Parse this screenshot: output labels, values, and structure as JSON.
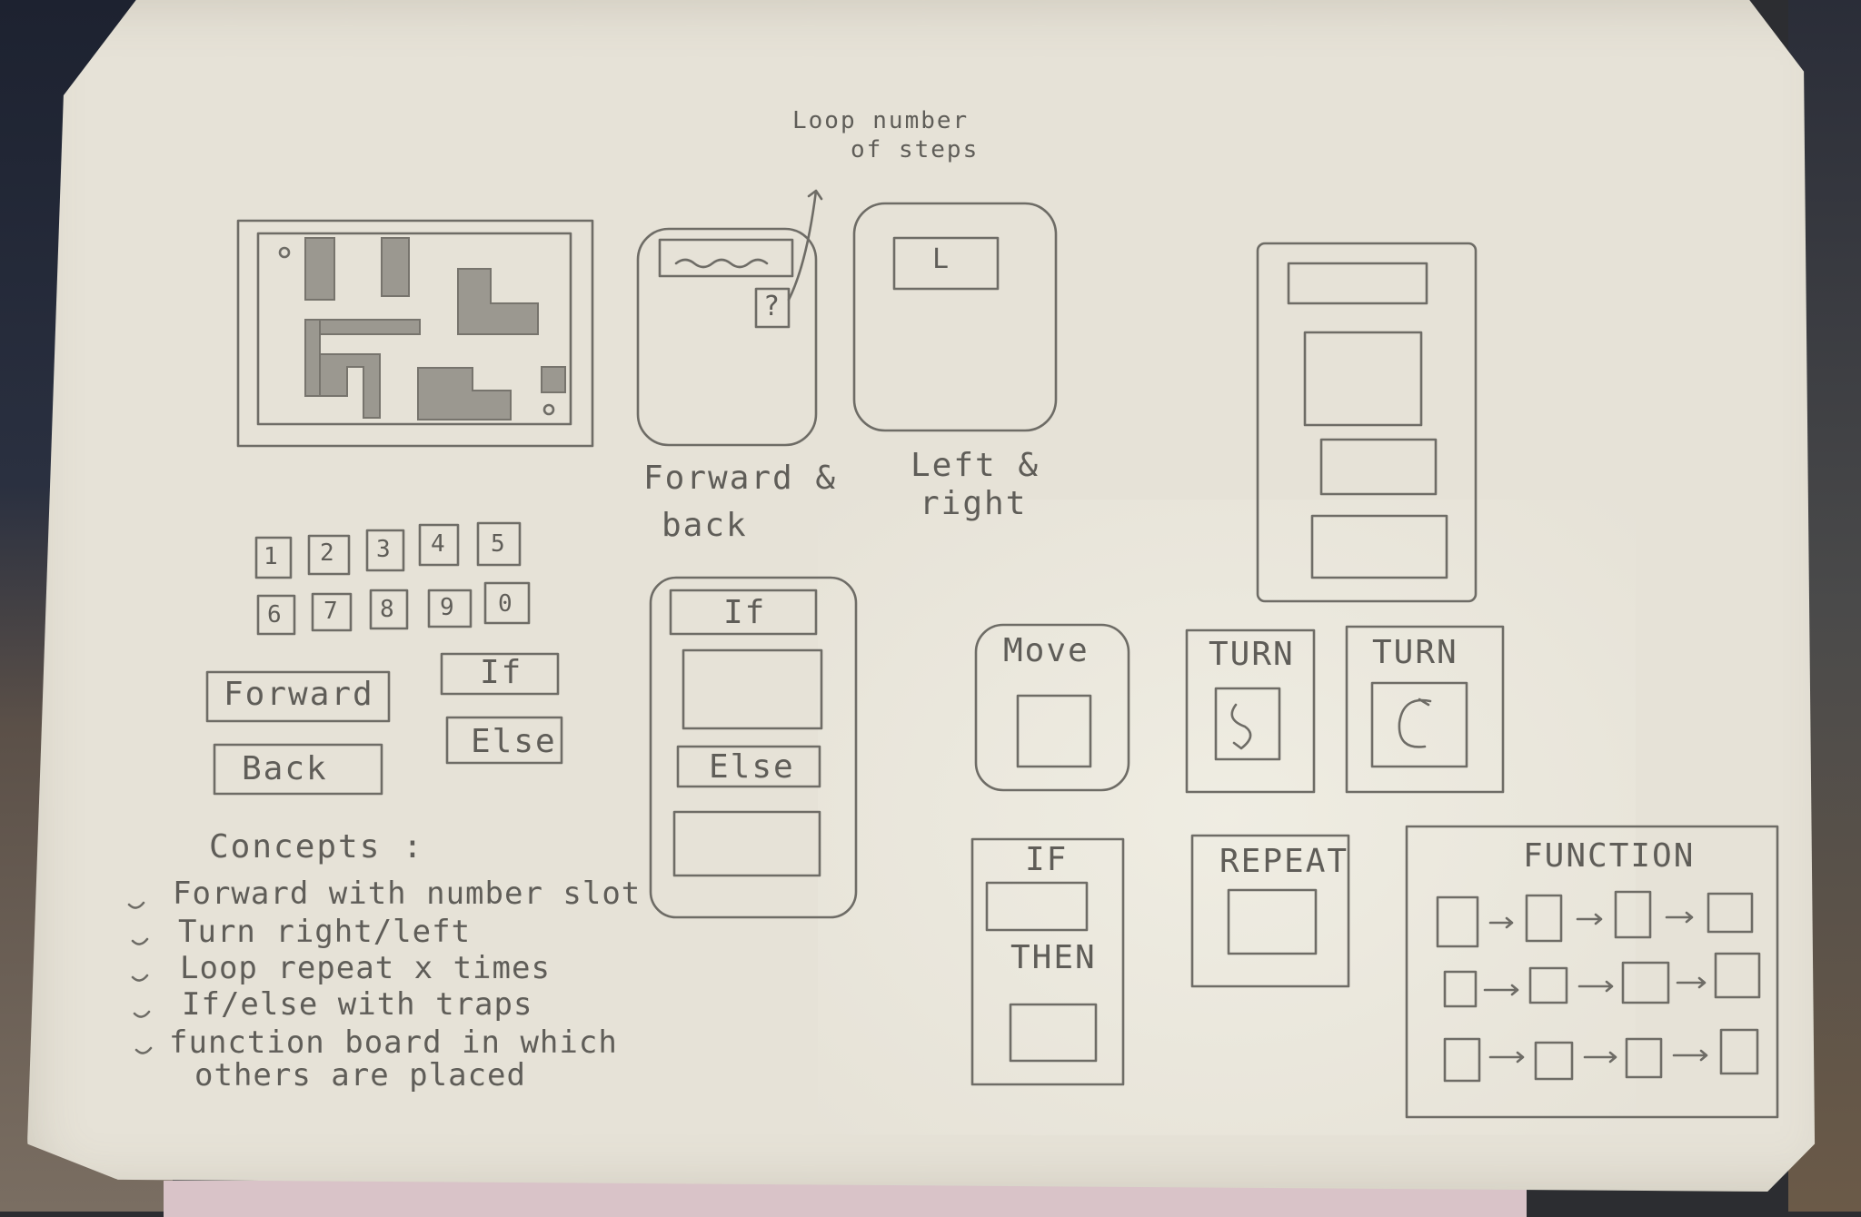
{
  "annotation": {
    "loop_note_line1": "Loop number",
    "loop_note_line2": "of steps"
  },
  "cards": {
    "forward_back_label_line1": "Forward &",
    "forward_back_label_line2": "back",
    "forward_back_slot": "?",
    "left_right_label_line1": "Left &",
    "left_right_label_line2": "right",
    "left_right_slot": "L"
  },
  "number_tiles": [
    "1",
    "2",
    "3",
    "4",
    "5",
    "6",
    "7",
    "8",
    "9",
    "0"
  ],
  "word_blocks": {
    "forward": "Forward",
    "back": "Back",
    "if": "If",
    "else": "Else"
  },
  "if_else_card": {
    "if": "If",
    "else": "Else"
  },
  "blocks": {
    "move": "Move",
    "turn_left": "TURN",
    "turn_right": "TURN",
    "if": "IF",
    "then": "THEN",
    "repeat": "REPEAT",
    "function": "FUNCTION"
  },
  "concepts": {
    "title": "Concepts :",
    "items": [
      "Forward with number slot",
      "Turn right/left",
      "Loop repeat x times",
      "If/else with traps",
      "function board in which",
      "others are placed"
    ]
  }
}
